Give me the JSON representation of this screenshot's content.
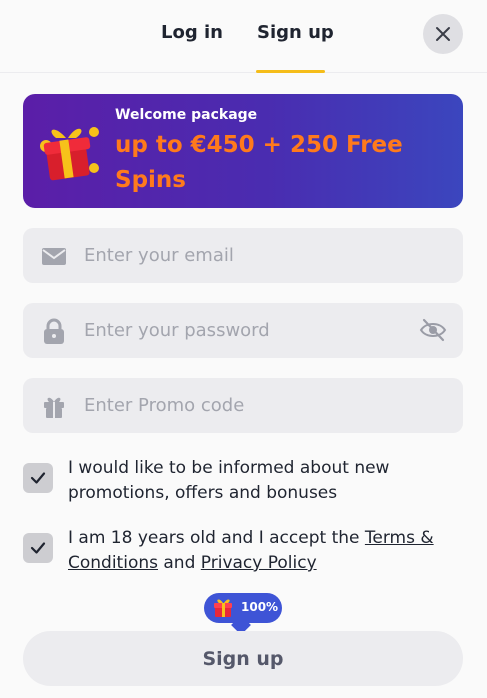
{
  "tabs": {
    "login_label": "Log in",
    "signup_label": "Sign up",
    "active": "signup"
  },
  "banner": {
    "subtitle": "Welcome package",
    "title": "up to €450 + 250 Free Spins",
    "icon": "gift-box-icon"
  },
  "form": {
    "email_placeholder": "Enter your email",
    "password_placeholder": "Enter your password",
    "promo_placeholder": "Enter Promo code"
  },
  "consents": {
    "promo_text": "I would like to be informed about new promotions, offers and bonuses",
    "promo_checked": true,
    "terms_prefix": "I am 18 years old and I accept the ",
    "terms_link": "Terms & Conditions",
    "terms_and": " and ",
    "privacy_link": "Privacy Policy",
    "terms_checked": true
  },
  "progress_badge": {
    "value": "100%",
    "progress": 1.0
  },
  "submit": {
    "label": "Sign up"
  },
  "colors": {
    "accent_underline": "#f5bd19",
    "banner_gradient_start": "#5b1ea8",
    "banner_gradient_end": "#3b46be",
    "banner_title": "#ff7a1c",
    "badge": "#3e54d6"
  }
}
